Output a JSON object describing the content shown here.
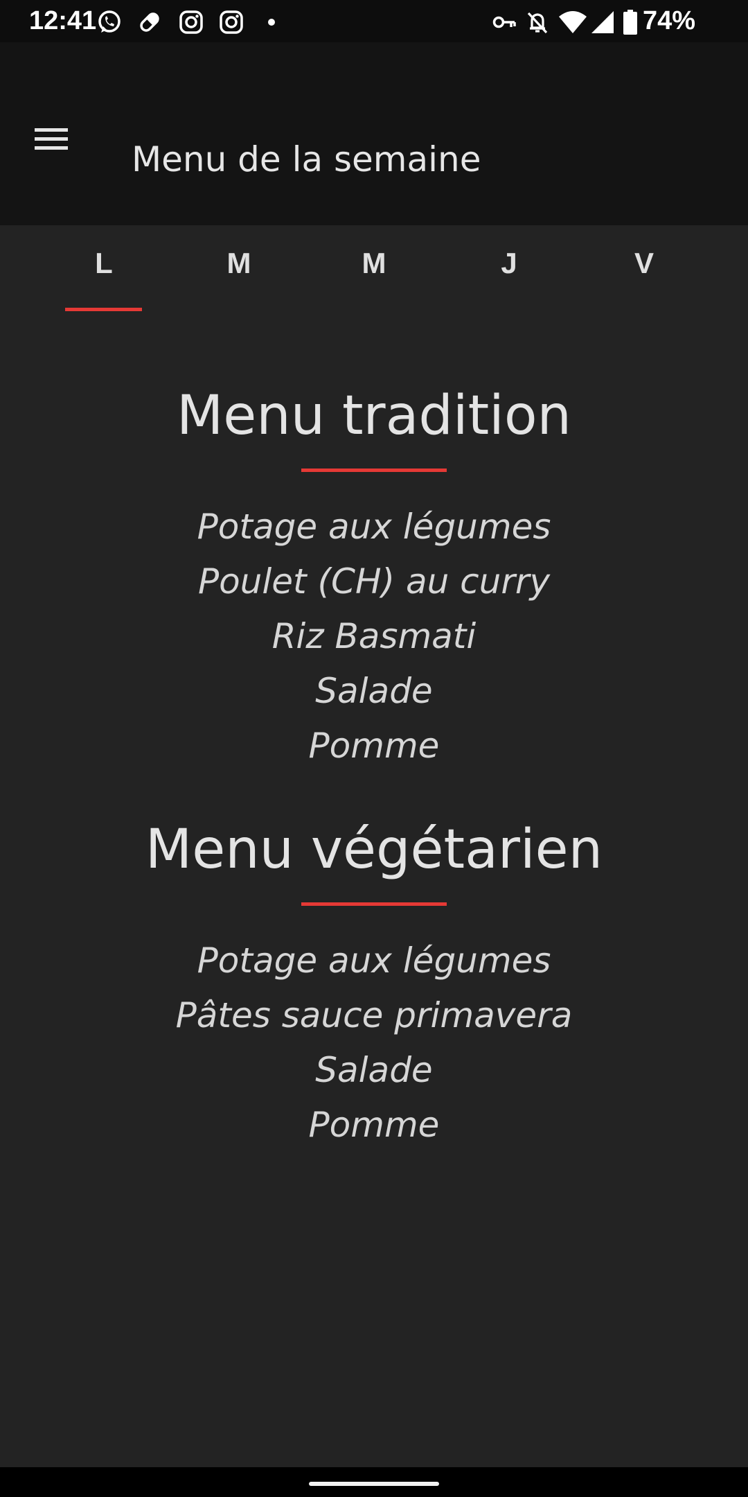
{
  "status_bar": {
    "time": "12:41",
    "battery_percent": "74%",
    "icons_left": [
      "whatsapp-icon",
      "pill-icon",
      "instagram-icon",
      "instagram-icon",
      "dot-icon"
    ],
    "icons_right": [
      "vpn-key-icon",
      "bell-off-icon",
      "wifi-icon",
      "signal-icon",
      "battery-icon"
    ]
  },
  "app_bar": {
    "title": "Menu de la semaine",
    "menu_icon": "hamburger-menu-icon"
  },
  "tabs": [
    {
      "label": "L",
      "selected": true
    },
    {
      "label": "M",
      "selected": false
    },
    {
      "label": "M",
      "selected": false
    },
    {
      "label": "J",
      "selected": false
    },
    {
      "label": "V",
      "selected": false
    }
  ],
  "menus": [
    {
      "title": "Menu tradition",
      "dishes": [
        "Potage aux légumes",
        "Poulet (CH) au curry",
        "Riz Basmati",
        "Salade",
        "Pomme"
      ]
    },
    {
      "title": "Menu végétarien",
      "dishes": [
        "Potage aux légumes",
        "Pâtes sauce primavera",
        "Salade",
        "Pomme"
      ]
    }
  ],
  "colors": {
    "accent": "#e53935",
    "background": "#232323",
    "app_bar": "#141414",
    "status_bar": "#0d0d0d"
  }
}
